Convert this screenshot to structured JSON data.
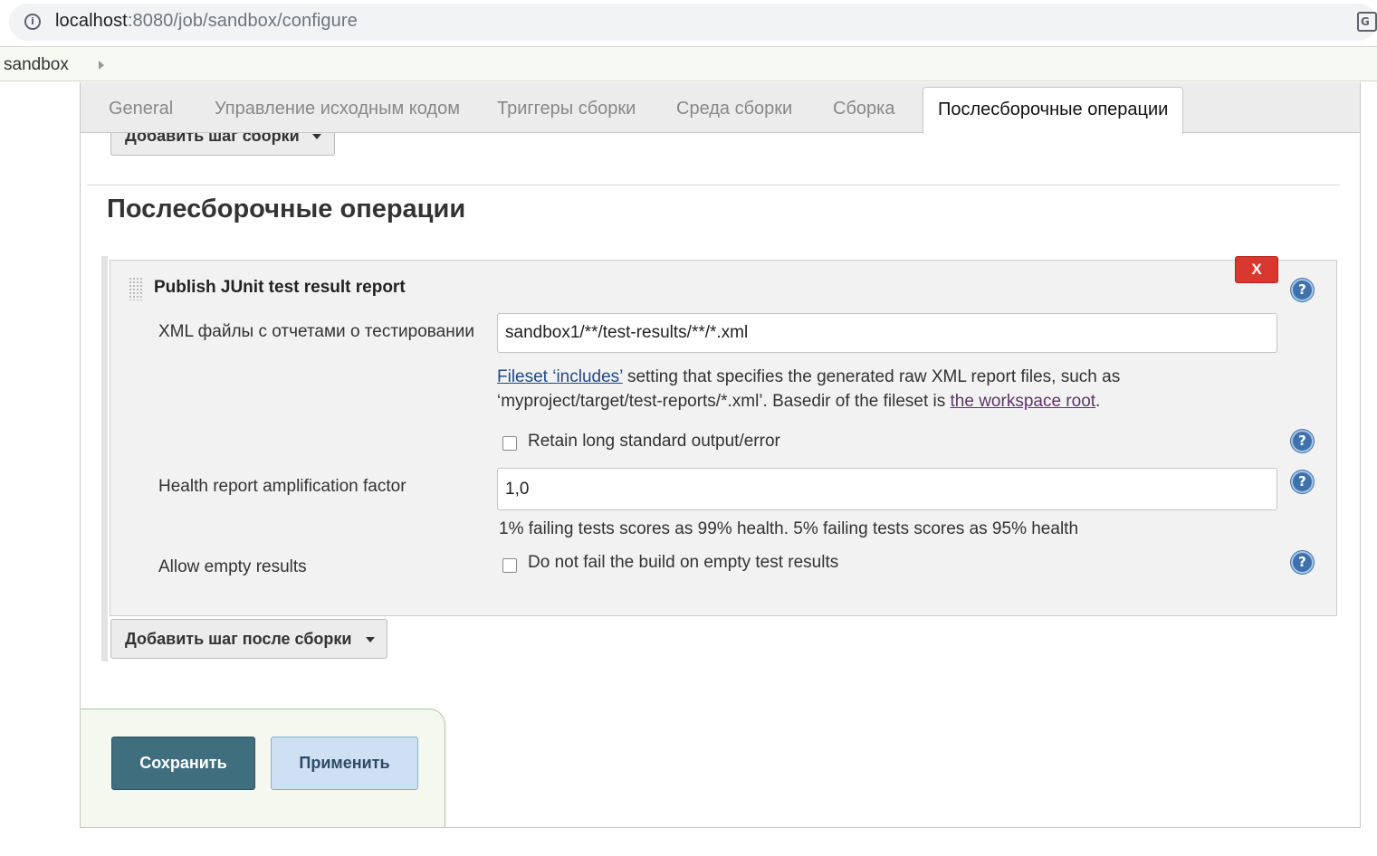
{
  "browser": {
    "url_host": "localhost",
    "url_path": ":8080/job/sandbox/configure"
  },
  "breadcrumb": {
    "item": "sandbox"
  },
  "tabs": [
    {
      "label": "General",
      "active": false
    },
    {
      "label": "Управление исходным кодом",
      "active": false
    },
    {
      "label": "Триггеры сборки",
      "active": false
    },
    {
      "label": "Среда сборки",
      "active": false
    },
    {
      "label": "Сборка",
      "active": false
    },
    {
      "label": "Послесборочные операции",
      "active": true
    }
  ],
  "build": {
    "add_step_label": "Добавить шаг сборки"
  },
  "post_build": {
    "section_title": "Послесборочные операции",
    "step": {
      "title": "Publish JUnit test result report",
      "delete_label": "X",
      "xml_label": "XML файлы с отчетами о тестировании",
      "xml_value": "sandbox1/**/test-results/**/*.xml",
      "xml_desc_link1": "Fileset ‘includes’",
      "xml_desc_text1": " setting that specifies the generated raw XML report files, such as",
      "xml_desc_text2": "‘myproject/target/test-reports/*.xml’. Basedir of the fileset is ",
      "xml_desc_link2": "the workspace root",
      "xml_desc_text3": ".",
      "retain_label": "Retain long standard output/error",
      "retain_checked": false,
      "health_label": "Health report amplification factor",
      "health_value": "1,0",
      "health_desc": "1% failing tests scores as 99% health. 5% failing tests scores as 95% health",
      "allow_empty_label": "Allow empty results",
      "allow_empty_checkbox_label": "Do not fail the build on empty test results",
      "allow_empty_checked": false
    },
    "add_post_step_label": "Добавить шаг после сборки"
  },
  "actions": {
    "save_label": "Сохранить",
    "apply_label": "Применить"
  },
  "icons": {
    "help": "?",
    "info": "i",
    "translate": "G"
  },
  "colors": {
    "delete_button": "#d9382f",
    "save_button": "#3f6e7f",
    "apply_button": "#cfe0f3",
    "help_icon": "#3f72ad",
    "link": "#204a87"
  }
}
